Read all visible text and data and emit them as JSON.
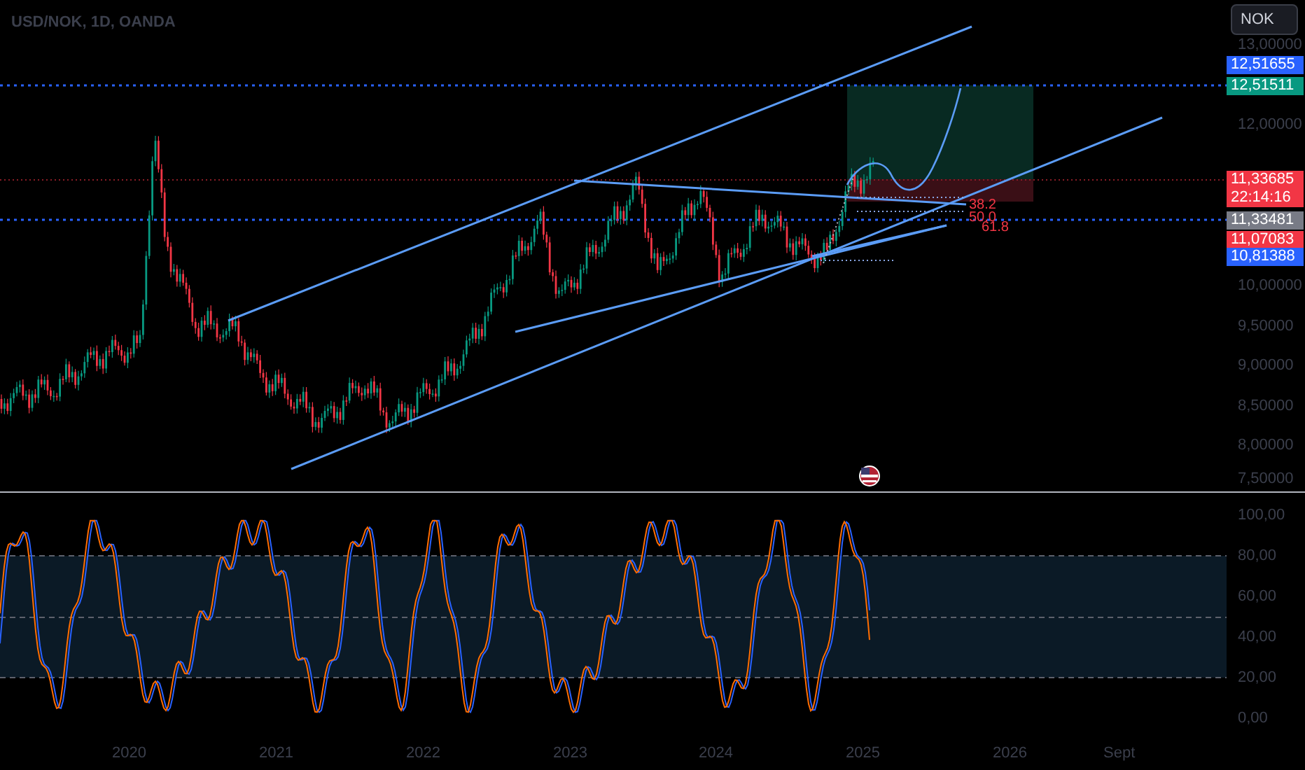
{
  "symbol_title": "USD/NOK, 1D, OANDA",
  "currency_button": "NOK",
  "price_axis": [
    "13,00000",
    "12,00000",
    "10,00000",
    "9,50000",
    "9,00000",
    "8,50000",
    "8,00000",
    "7,50000"
  ],
  "price_tags": [
    {
      "text": "12,51655",
      "color": "#2962ff"
    },
    {
      "text": "12,51511",
      "color": "#089981"
    },
    {
      "text": "11,33685",
      "subtext": "22:14:16",
      "color": "#f23645"
    },
    {
      "text": "11,33481",
      "color": "#787b86"
    },
    {
      "text": "11,07083",
      "color": "#f23645"
    },
    {
      "text": "10,81388",
      "color": "#2962ff"
    }
  ],
  "fib_levels": [
    "38.2",
    "50.0",
    "61.8"
  ],
  "oscillator_axis": [
    "100,00",
    "80,00",
    "60,00",
    "40,00",
    "20,00",
    "0,00"
  ],
  "time_axis": [
    "2020",
    "2021",
    "2022",
    "2023",
    "2024",
    "2025",
    "2026",
    "Sept"
  ]
}
